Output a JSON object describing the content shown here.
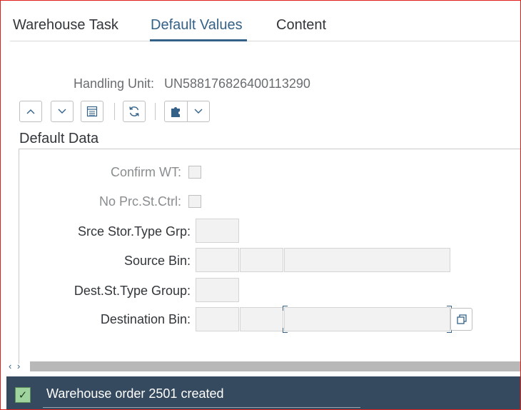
{
  "tabs": [
    {
      "label": "Warehouse Task"
    },
    {
      "label": "Default Values",
      "active": true
    },
    {
      "label": "Content"
    }
  ],
  "handling_unit": {
    "label": "Handling Unit:",
    "value": "UN588176826400113290"
  },
  "toolbar": {
    "icons": [
      "chevron-up-icon",
      "chevron-down-icon",
      "list-icon",
      "refresh-icon",
      "puzzle-icon",
      "dropdown-chevron-icon"
    ]
  },
  "section": {
    "title": "Default Data",
    "fields": {
      "confirm_wt": {
        "label": "Confirm WT:",
        "checked": false
      },
      "no_prc_st_ctrl": {
        "label": "No Prc.St.Ctrl:",
        "checked": false
      },
      "srce_stor_type_grp": {
        "label": "Srce Stor.Type Grp:",
        "value": ""
      },
      "source_bin": {
        "label": "Source Bin:",
        "values": [
          "",
          "",
          ""
        ]
      },
      "dest_st_type_group": {
        "label": "Dest.St.Type Group:",
        "value": ""
      },
      "destination_bin": {
        "label": "Destination Bin:",
        "values": [
          "",
          "",
          ""
        ]
      }
    }
  },
  "scroll": {
    "left_arrow": "‹",
    "right_arrow": "›"
  },
  "status": {
    "message": "Warehouse order 2501 created",
    "type": "success",
    "icon": "checkmark-icon"
  },
  "colors": {
    "accent": "#346187",
    "status_bar": "#354a5f",
    "success": "#9fd49f",
    "frame": "#e0201b"
  }
}
